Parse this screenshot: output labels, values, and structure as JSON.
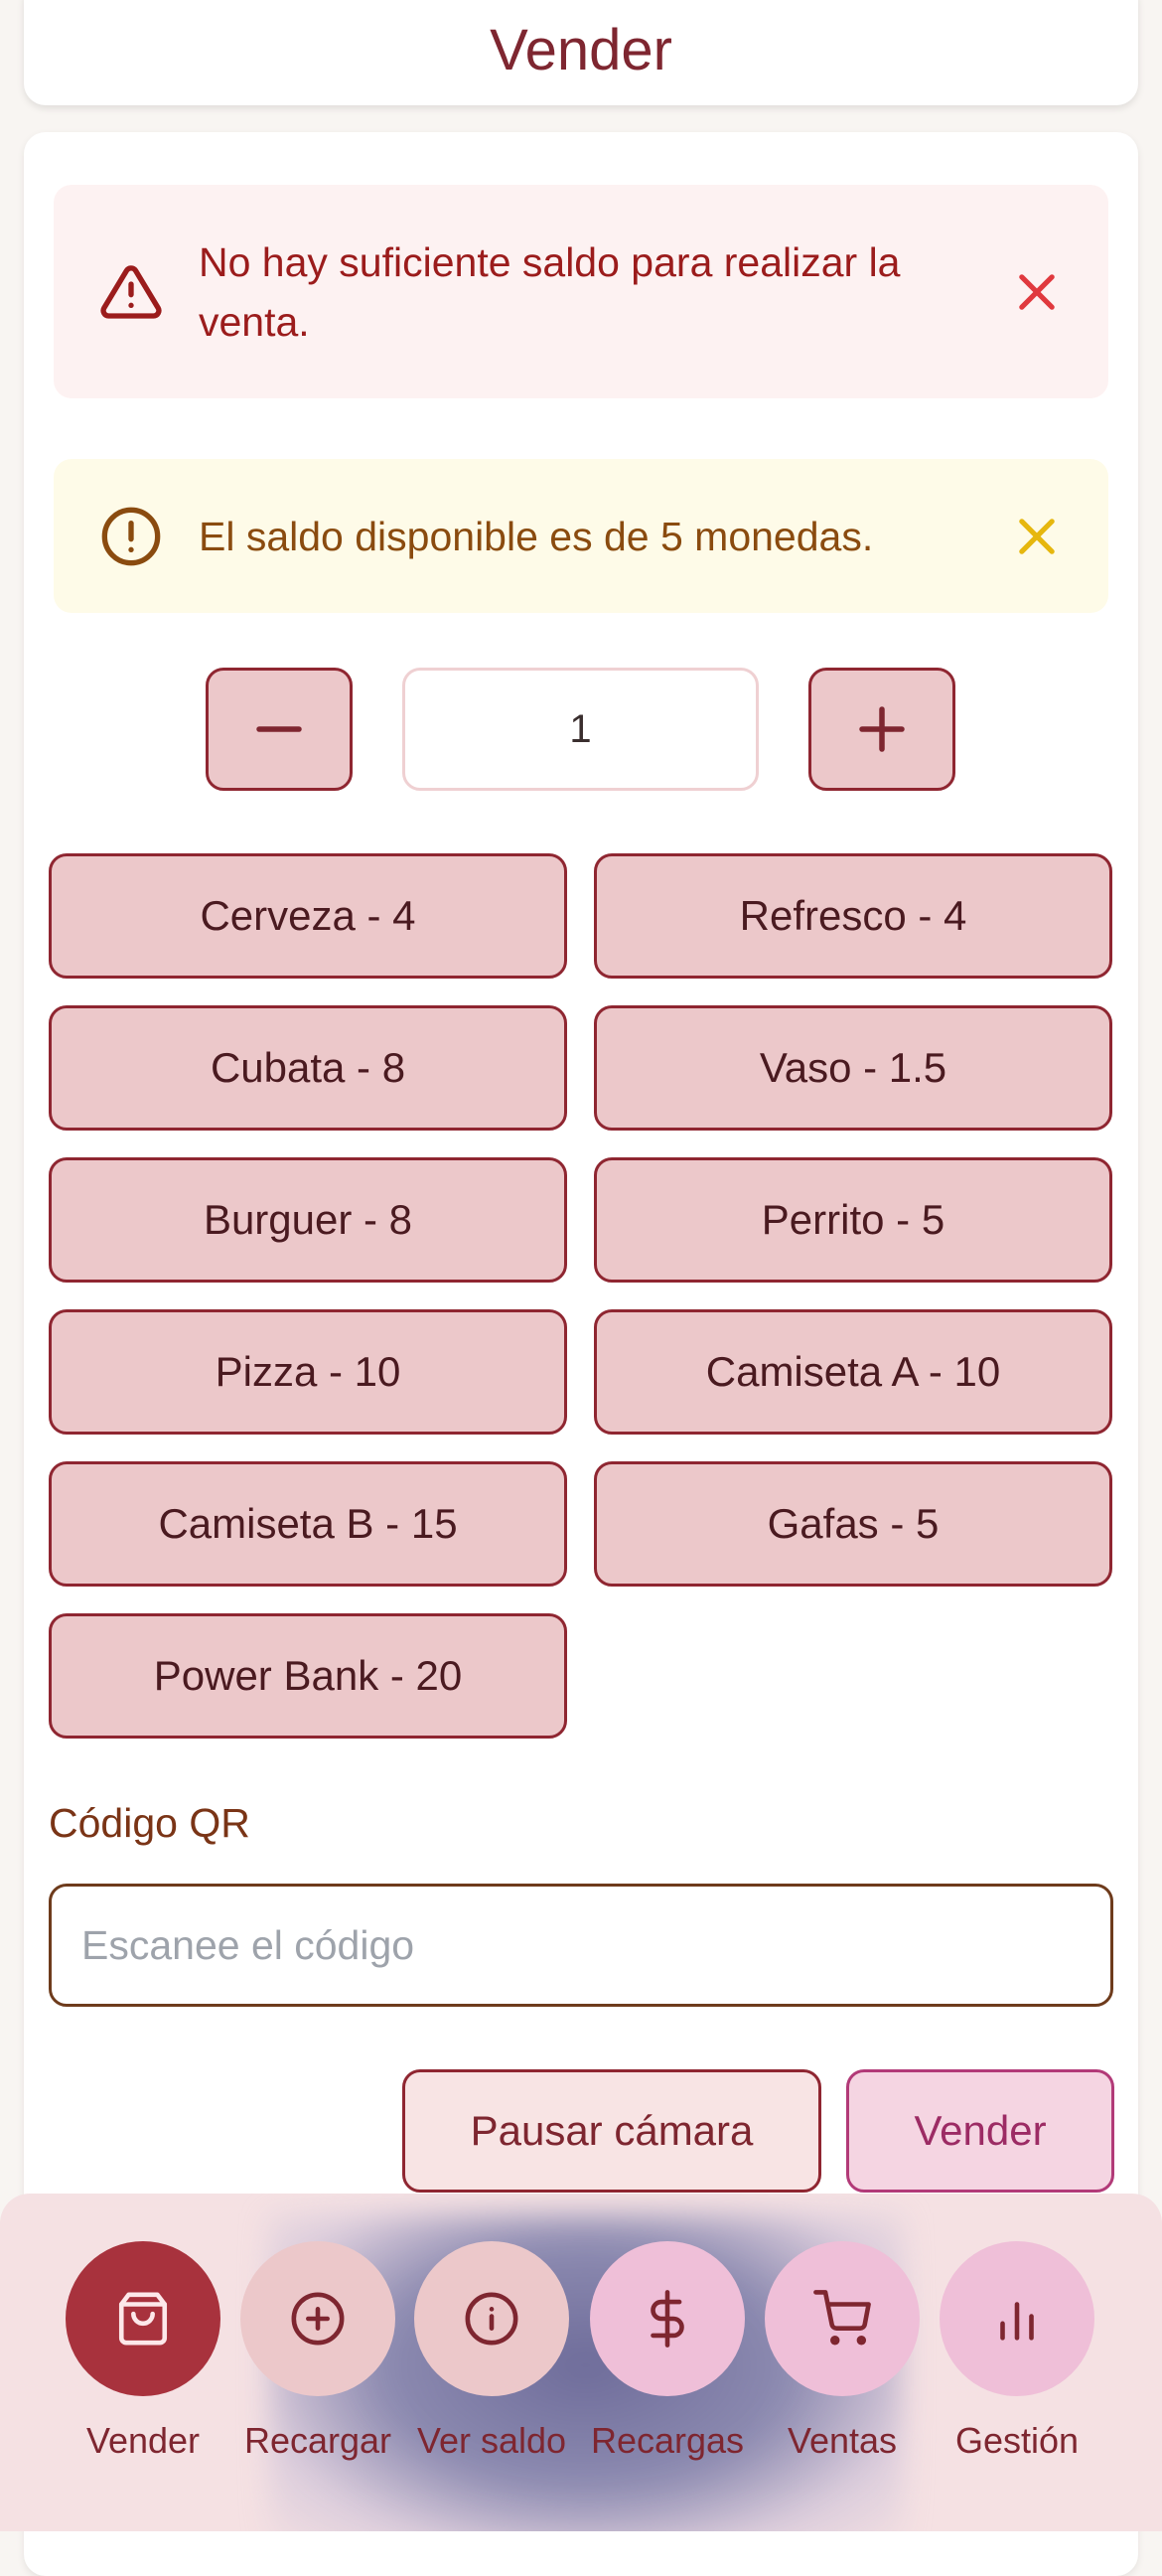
{
  "header": {
    "title": "Vender"
  },
  "alerts": {
    "error": {
      "text": "No hay suficiente saldo para realizar la venta.",
      "icon": "warning-triangle-icon",
      "color": "#dc2626"
    },
    "warning": {
      "text": "El saldo disponible es de 5 monedas.",
      "icon": "exclamation-circle-icon",
      "color": "#eab308"
    }
  },
  "quantity": {
    "value": "1"
  },
  "products": [
    {
      "label": "Cerveza - 4"
    },
    {
      "label": "Refresco - 4"
    },
    {
      "label": "Cubata - 8"
    },
    {
      "label": "Vaso - 1.5"
    },
    {
      "label": "Burguer - 8"
    },
    {
      "label": "Perrito - 5"
    },
    {
      "label": "Pizza - 10"
    },
    {
      "label": "Camiseta A - 10"
    },
    {
      "label": "Camiseta B - 15"
    },
    {
      "label": "Gafas - 5"
    },
    {
      "label": "Power Bank - 20"
    }
  ],
  "qr": {
    "label": "Código QR",
    "placeholder": "Escanee el código",
    "value": ""
  },
  "actions": {
    "pause_label": "Pausar cámara",
    "sell_label": "Vender"
  },
  "nav": {
    "active": "Vender",
    "items": [
      {
        "label": "Vender",
        "icon": "shopping-bag-icon"
      },
      {
        "label": "Recargar",
        "icon": "plus-circle-icon"
      },
      {
        "label": "Ver saldo",
        "icon": "info-circle-icon"
      },
      {
        "label": "Recargas",
        "icon": "dollar-icon"
      },
      {
        "label": "Ventas",
        "icon": "cart-icon"
      },
      {
        "label": "Gestión",
        "icon": "bar-chart-icon"
      }
    ]
  },
  "colors": {
    "primary": "#a8323d",
    "product_bg": "#ecc8ca",
    "accent_pink": "#f0c0d8"
  }
}
